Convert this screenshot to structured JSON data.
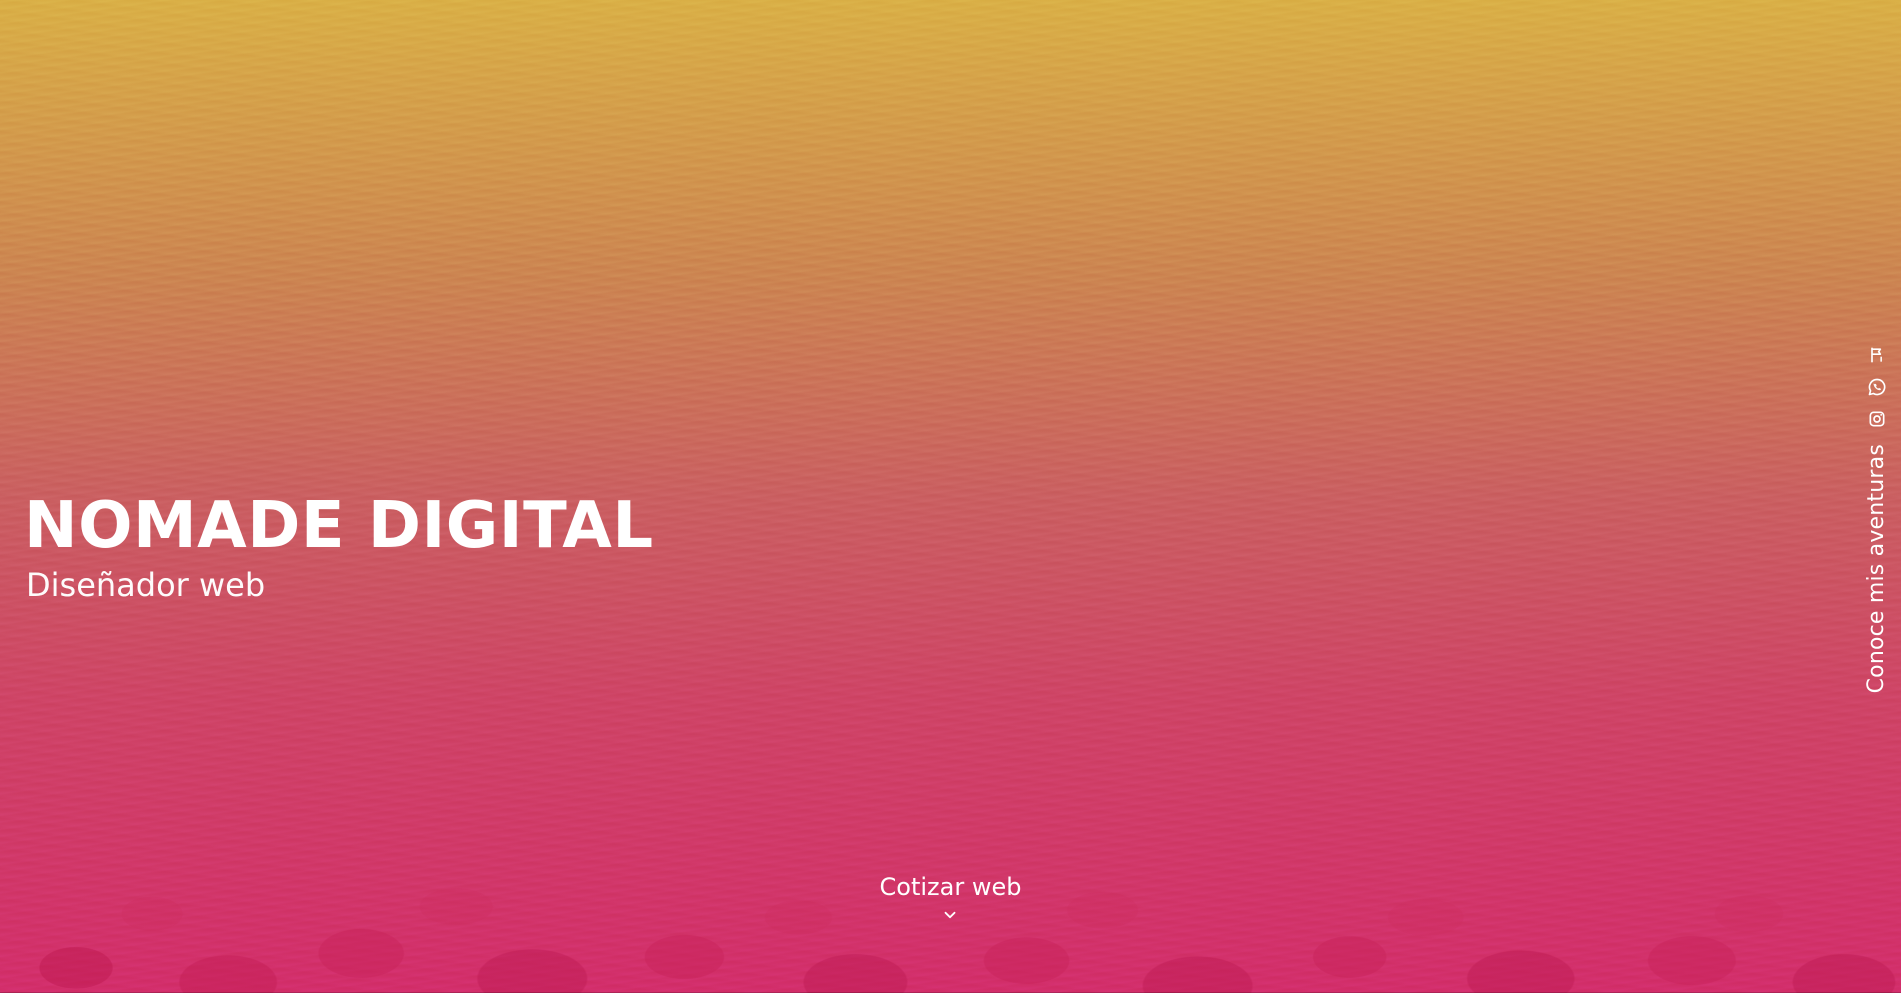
{
  "hero": {
    "title": "NOMADE DIGITAL",
    "subtitle": "Diseñador web"
  },
  "cta": {
    "label": "Cotizar web",
    "icon": "chevron-down-icon"
  },
  "side": {
    "vertical_text": "Conoce mis aventuras",
    "icons": [
      {
        "name": "social-icon-1",
        "glyph": "flag"
      },
      {
        "name": "whatsapp-icon",
        "glyph": "whatsapp"
      },
      {
        "name": "instagram-icon",
        "glyph": "instagram"
      }
    ]
  },
  "colors": {
    "text": "#ffffff",
    "gradient_top": "#ECBE4C",
    "gradient_mid": "#E66C6E",
    "gradient_bottom": "#DE3070"
  }
}
